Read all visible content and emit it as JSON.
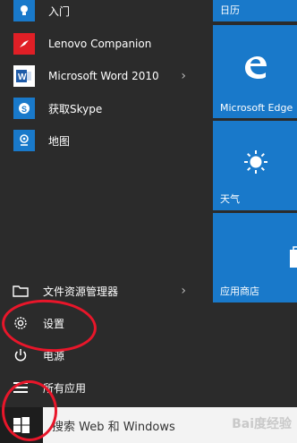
{
  "apps": [
    {
      "label": "入门",
      "icon": "lightbulb-icon"
    },
    {
      "label": "Lenovo Companion",
      "icon": "lenovo-companion-icon"
    },
    {
      "label": "Microsoft Word 2010",
      "icon": "word-icon"
    },
    {
      "label": "获取Skype",
      "icon": "skype-icon"
    },
    {
      "label": "地图",
      "icon": "maps-icon"
    }
  ],
  "system": {
    "explorer": "文件资源管理器",
    "settings": "设置",
    "power": "电源",
    "all_apps": "所有应用"
  },
  "tiles": {
    "calendar": "日历",
    "edge": "Microsoft Edge",
    "weather": "天气",
    "store": "应用商店"
  },
  "taskbar": {
    "search_text": "搜索 Web 和 Windows"
  },
  "watermark": "Bai度经验",
  "colors": {
    "tile_blue": "#1979ca",
    "lenovo_red": "#e01f26",
    "annotation_red": "#e8162a"
  }
}
